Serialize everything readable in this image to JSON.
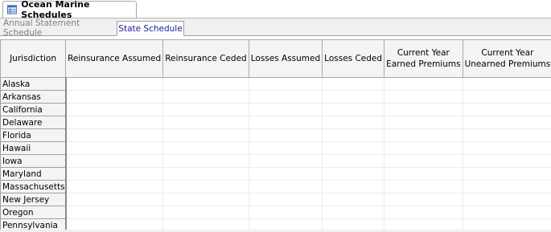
{
  "document_tab": {
    "title": "Ocean Marine Schedules",
    "icon": "grid-icon"
  },
  "tabs": [
    {
      "label": "Annual Statement Schedule",
      "active": false
    },
    {
      "label": "State Schedule",
      "active": true
    }
  ],
  "grid": {
    "headers": {
      "jurisdiction": "Jurisdiction",
      "reinsurance_assumed": "Reinsurance Assumed",
      "reinsurance_ceded": "Reinsurance Ceded",
      "losses_assumed": "Losses Assumed",
      "losses_ceded": "Losses Ceded",
      "current_year_earned_1": "Current Year",
      "current_year_earned_2": "Earned Premiums",
      "current_year_unearned_1": "Current Year",
      "current_year_unearned_2": "Unearned Premiums"
    },
    "rows": [
      "Alaska",
      "Arkansas",
      "California",
      "Delaware",
      "Florida",
      "Hawaii",
      "Iowa",
      "Maryland",
      "Massachusetts",
      "New Jersey",
      "Oregon",
      "Pennsylvania"
    ]
  }
}
